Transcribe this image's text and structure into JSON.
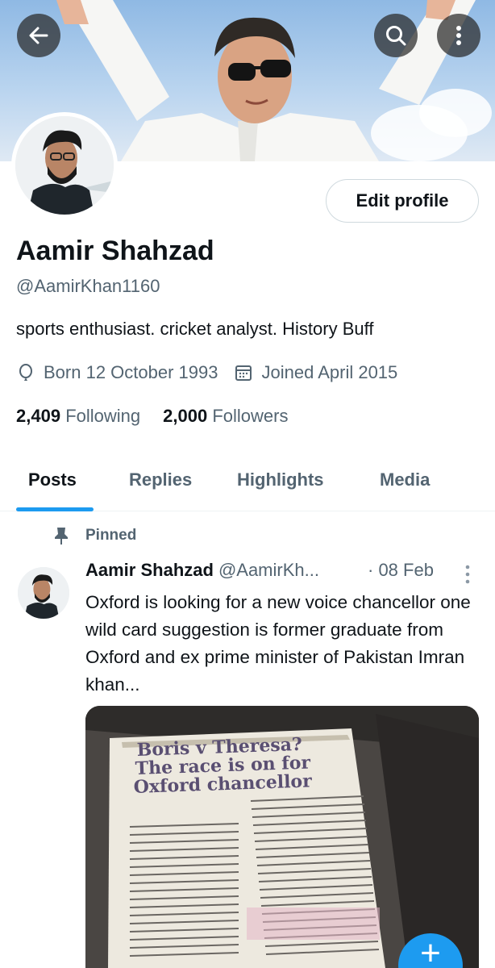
{
  "header": {
    "back_icon": "arrow-left-icon",
    "search_icon": "search-icon",
    "more_icon": "more-vertical-icon"
  },
  "profile": {
    "name": "Aamir Shahzad",
    "handle": "@AamirKhan1160",
    "bio": "sports enthusiast. cricket analyst. History Buff",
    "birth": "Born 12 October 1993",
    "joined": "Joined April 2015",
    "following_count": "2,409",
    "following_label": "Following",
    "followers_count": "2,000",
    "followers_label": "Followers",
    "edit_label": "Edit profile"
  },
  "tabs": [
    {
      "label": "Posts",
      "active": true
    },
    {
      "label": "Replies",
      "active": false
    },
    {
      "label": "Highlights",
      "active": false
    },
    {
      "label": "Media",
      "active": false
    }
  ],
  "post": {
    "pinned_label": "Pinned",
    "author_name": "Aamir Shahzad",
    "author_handle": "@AamirKh...",
    "date": "· 08 Feb",
    "text": "Oxford is looking for a new voice chancellor one wild card suggestion is former graduate from Oxford and ex prime minister of Pakistan Imran khan...",
    "image": {
      "headline_line1": "Boris v Theresa?",
      "headline_line2": "The race is on for",
      "headline_line3": "Oxford chancellor"
    }
  },
  "fab": {
    "label": "+"
  },
  "colors": {
    "accent": "#1d9bf0",
    "text": "#0f1419",
    "muted": "#536471",
    "border": "#cfd9de"
  }
}
